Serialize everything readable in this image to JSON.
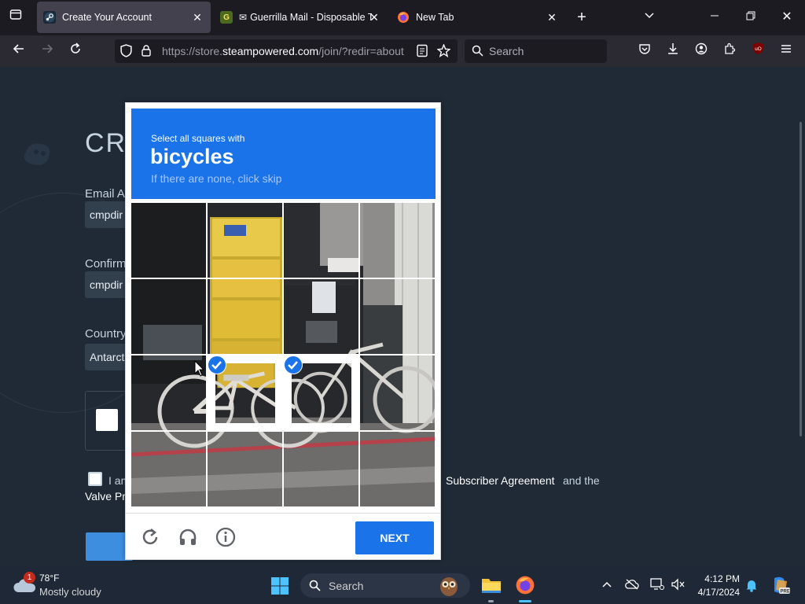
{
  "browser": {
    "tabs": [
      {
        "title": "Create Your Account",
        "active": true
      },
      {
        "title": "Guerrilla Mail - Disposable Te",
        "active": false
      },
      {
        "title": "New Tab",
        "active": false
      }
    ],
    "url_prefix": "https://store.",
    "url_domain": "steampowered.com",
    "url_suffix": "/join/?redir=about",
    "search_placeholder": "Search",
    "icons": [
      "firefox-view-icon",
      "back-icon",
      "forward-icon",
      "reload-icon",
      "shield-icon",
      "lock-icon",
      "reader-view-icon",
      "bookmark-star-icon",
      "pocket-icon",
      "downloads-icon",
      "account-icon",
      "extensions-icon",
      "ublock-icon",
      "menu-icon"
    ]
  },
  "page": {
    "heading": "CR",
    "email_label": "Email Ac",
    "email_value": "cmpdir",
    "confirm_label": "Confirm",
    "confirm_value": "cmpdir",
    "country_label": "Country",
    "country_value": "Antarct",
    "agree_text": "I am",
    "agreement_link": "Subscriber Agreement",
    "and_the": "and the",
    "privacy_link": "Valve Pr"
  },
  "captcha": {
    "instruction": "Select all squares with",
    "target": "bicycles",
    "hint": "If there are none, click skip",
    "selected_tiles": [
      9,
      10
    ],
    "next_label": "NEXT",
    "accent_color": "#1a73e8"
  },
  "taskbar": {
    "weather_badge": "1",
    "temperature": "78°F",
    "weather": "Mostly cloudy",
    "search_placeholder": "Search",
    "time": "4:12 PM",
    "date": "4/17/2024"
  }
}
